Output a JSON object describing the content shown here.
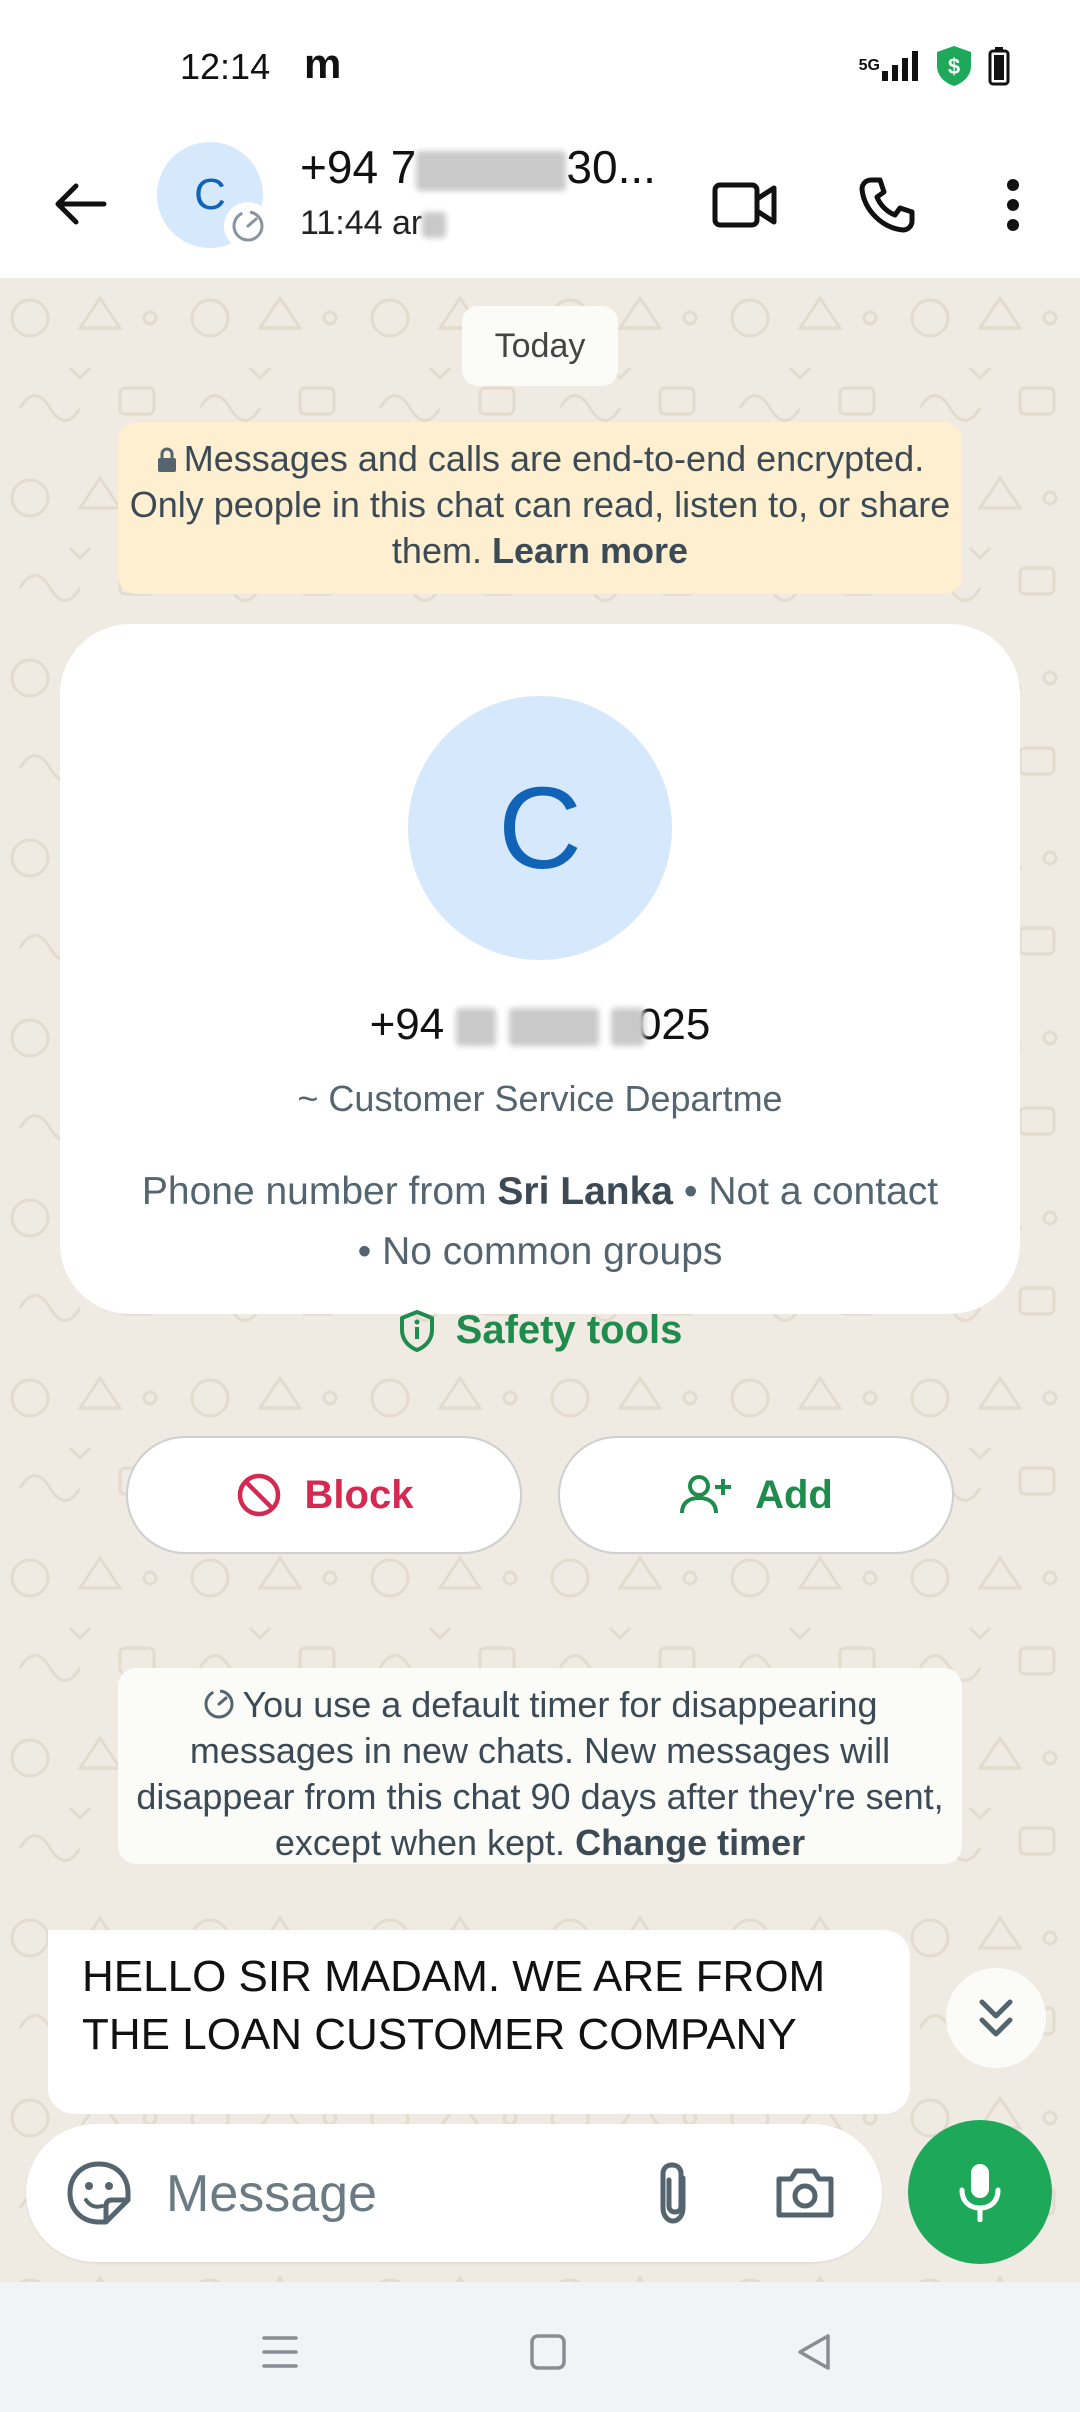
{
  "status_bar": {
    "time": "12:14",
    "carrier_icon": "m",
    "network": "5G"
  },
  "header": {
    "avatar_letter": "C",
    "name_prefix": "+94 7",
    "name_suffix": "30...",
    "subtitle_prefix": "11:44 ar",
    "icons": [
      "back-arrow-icon",
      "video-call-icon",
      "voice-call-icon",
      "more-vert-icon"
    ]
  },
  "chat": {
    "date_chip": "Today",
    "encryption": {
      "text": "Messages and calls are end-to-end encrypted. Only people in this chat can read, listen to, or share them.",
      "link": "Learn more"
    },
    "contact_card": {
      "avatar_letter": "C",
      "phone_prefix": "+94",
      "phone_suffix": "025",
      "alias": "~ Customer Service Departme",
      "info_prefix": "Phone number from",
      "info_country": "Sri Lanka",
      "info_suffix": "• Not a contact • No common groups",
      "safety_label": "Safety tools",
      "block_label": "Block",
      "add_label": "Add"
    },
    "timer_notice": {
      "text": "You use a default timer for disappearing messages in new chats. New messages will disappear from this chat 90 days after they're sent, except when kept.",
      "link": "Change timer"
    },
    "message": {
      "text": "HELLO SIR MADAM. WE ARE FROM THE LOAN CUSTOMER COMPANY"
    }
  },
  "composer": {
    "placeholder": "Message"
  },
  "colors": {
    "accent_green": "#1da85a",
    "block_red": "#d42a52",
    "avatar_bg": "#d6e8fb",
    "avatar_letter": "#1163b8",
    "encryption_bg": "#fdefcf",
    "chat_bg": "#efeae2"
  }
}
